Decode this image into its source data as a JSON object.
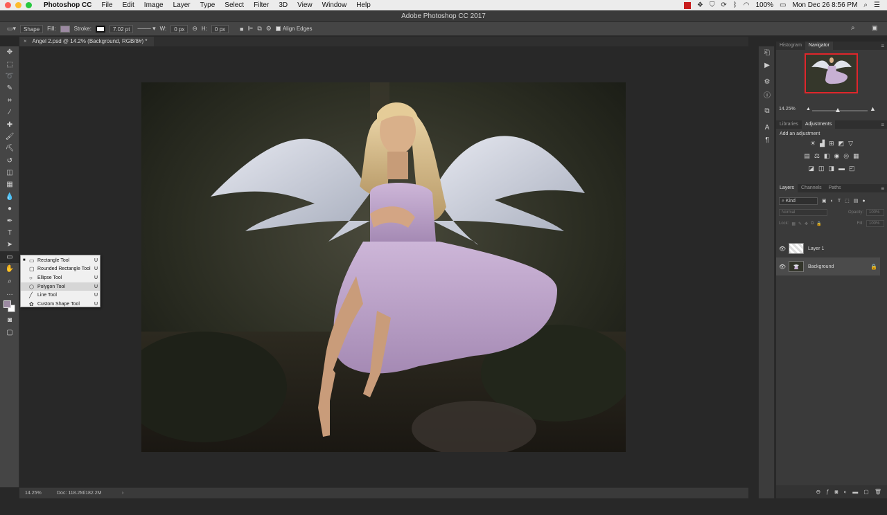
{
  "menubar": {
    "app_name": "Photoshop CC",
    "items": [
      "File",
      "Edit",
      "Image",
      "Layer",
      "Type",
      "Select",
      "Filter",
      "3D",
      "View",
      "Window",
      "Help"
    ],
    "battery": "100%",
    "datetime": "Mon Dec 26  8:56 PM"
  },
  "window": {
    "title": "Adobe Photoshop CC 2017"
  },
  "options": {
    "mode": "Shape",
    "fill_label": "Fill:",
    "fill_color": "#9c8aa2",
    "stroke_label": "Stroke:",
    "stroke_width": "7.02 pt",
    "w_label": "W:",
    "w_value": "0 px",
    "h_label": "H:",
    "h_value": "0 px",
    "align_edges": "Align Edges"
  },
  "document": {
    "tab_title": "Angel 2.psd @ 14.2% (Background, RGB/8#) *"
  },
  "flyout": {
    "items": [
      {
        "label": "Rectangle Tool",
        "key": "U",
        "icon": "rectangle-icon"
      },
      {
        "label": "Rounded Rectangle Tool",
        "key": "U",
        "icon": "rounded-rectangle-icon"
      },
      {
        "label": "Ellipse Tool",
        "key": "U",
        "icon": "ellipse-icon"
      },
      {
        "label": "Polygon Tool",
        "key": "U",
        "icon": "polygon-icon"
      },
      {
        "label": "Line Tool",
        "key": "U",
        "icon": "line-icon"
      },
      {
        "label": "Custom Shape Tool",
        "key": "U",
        "icon": "custom-shape-icon"
      }
    ],
    "current_index": 0,
    "hover_index": 3
  },
  "status": {
    "zoom": "14.25%",
    "doc": "Doc: 118.2M/182.2M"
  },
  "navigator": {
    "tabs": [
      "Histogram",
      "Navigator"
    ],
    "zoom": "14.25%",
    "zoom_level": 0.46
  },
  "adjustments": {
    "tabs": [
      "Libraries",
      "Adjustments"
    ],
    "title": "Add an adjustment"
  },
  "layers": {
    "tabs": [
      "Layers",
      "Channels",
      "Paths"
    ],
    "filter": "Kind",
    "blend_mode": "Normal",
    "opacity_label": "Opacity:",
    "opacity_value": "100%",
    "lock_label": "Lock:",
    "fill_label": "Fill:",
    "fill_value": "100%",
    "items": [
      {
        "name": "Layer 1",
        "selected": false,
        "locked": false
      },
      {
        "name": "Background",
        "selected": true,
        "locked": true
      }
    ]
  },
  "colors": {
    "foreground": "#9c8aa2",
    "background": "#ffffff",
    "accent": "#e0262b"
  }
}
